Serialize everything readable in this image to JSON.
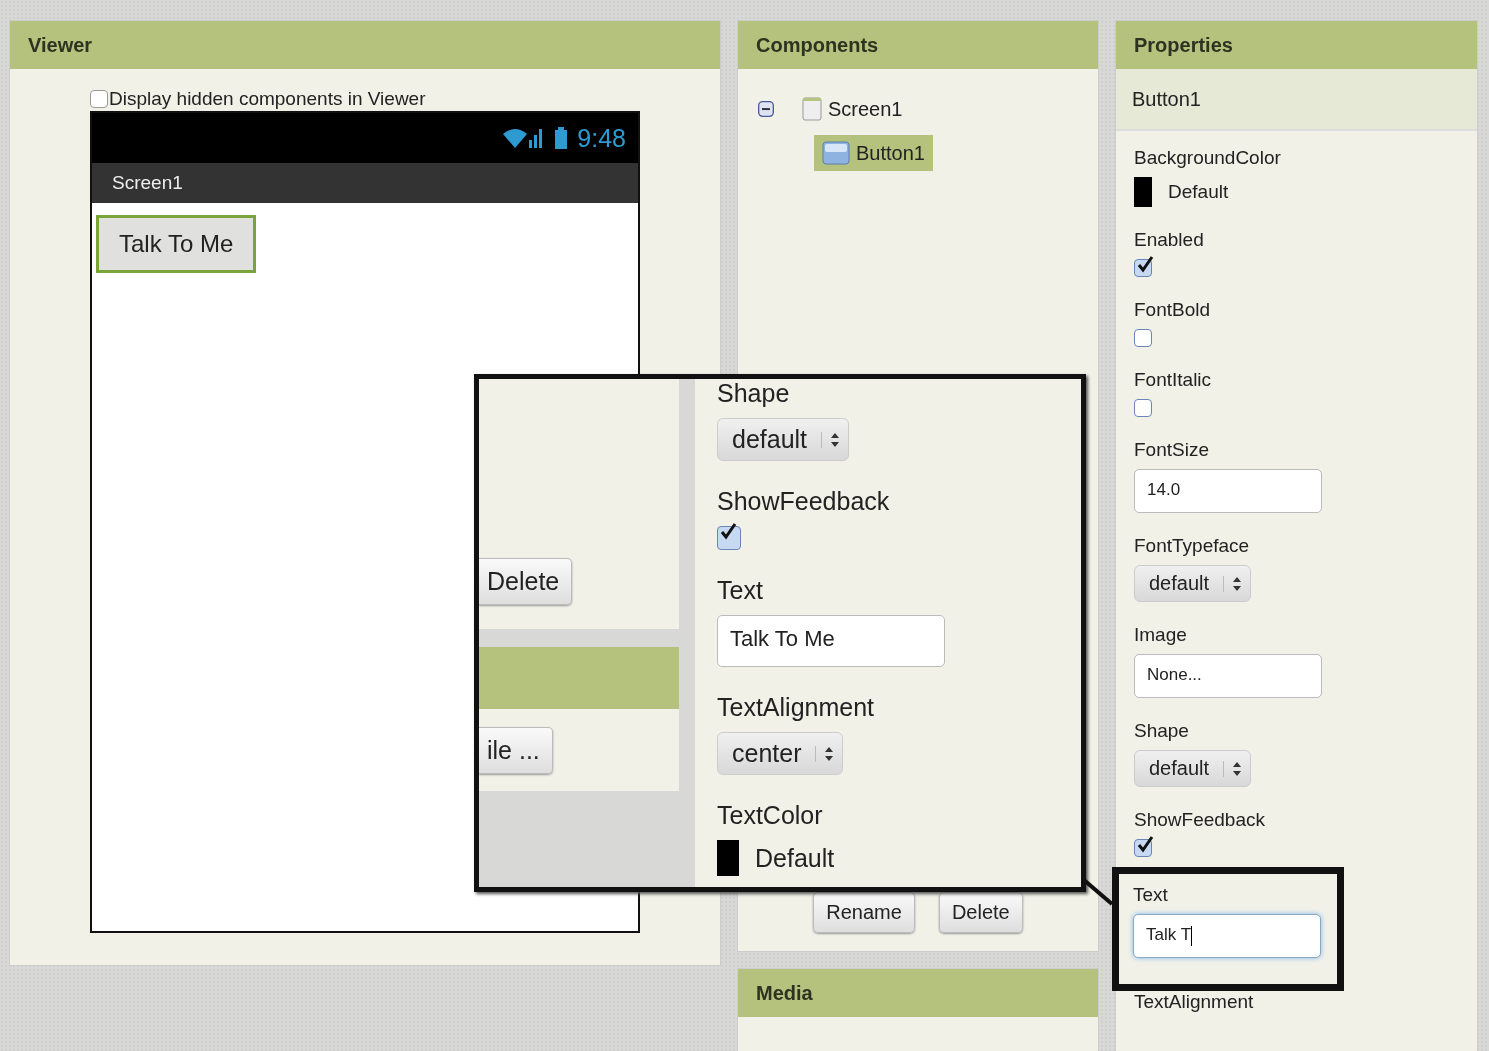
{
  "viewer": {
    "title": "Viewer",
    "display_hidden": {
      "label": "Display hidden components in Viewer",
      "checked": false
    },
    "phone": {
      "time": "9:48",
      "title": "Screen1",
      "button": "Talk To Me"
    }
  },
  "components": {
    "title": "Components",
    "tree": [
      {
        "label": "Screen1",
        "kind": "screen",
        "expanded": true,
        "selected": false,
        "children": [
          {
            "label": "Button1",
            "kind": "button",
            "selected": true
          }
        ]
      }
    ],
    "buttons": [
      "Rename",
      "Delete"
    ]
  },
  "media": {
    "title": "Media"
  },
  "properties": {
    "title": "Properties",
    "component": "Button1",
    "items": [
      {
        "kind": "color",
        "label": "BackgroundColor",
        "value": "Default"
      },
      {
        "kind": "checkbox",
        "label": "Enabled",
        "checked": true
      },
      {
        "kind": "checkbox",
        "label": "FontBold",
        "checked": false
      },
      {
        "kind": "checkbox",
        "label": "FontItalic",
        "checked": false
      },
      {
        "kind": "text",
        "label": "FontSize",
        "value": "14.0"
      },
      {
        "kind": "select",
        "label": "FontTypeface",
        "value": "default"
      },
      {
        "kind": "text",
        "label": "Image",
        "value": "None..."
      },
      {
        "kind": "select",
        "label": "Shape",
        "value": "default"
      },
      {
        "kind": "checkbox",
        "label": "ShowFeedback",
        "checked": true
      },
      {
        "kind": "text",
        "label": "Text",
        "value": "Talk T",
        "focused": true,
        "highlighted": true
      },
      {
        "kind": "label",
        "label": "TextAlignment"
      }
    ]
  },
  "callout": {
    "buttons": [
      "Delete",
      "ile ..."
    ],
    "items": [
      {
        "kind": "select",
        "label": "Shape",
        "value": "default"
      },
      {
        "kind": "checkbox",
        "label": "ShowFeedback",
        "checked": true
      },
      {
        "kind": "text",
        "label": "Text",
        "value": "Talk To Me"
      },
      {
        "kind": "select",
        "label": "TextAlignment",
        "value": "center"
      },
      {
        "kind": "color",
        "label": "TextColor",
        "value": "Default"
      }
    ]
  }
}
